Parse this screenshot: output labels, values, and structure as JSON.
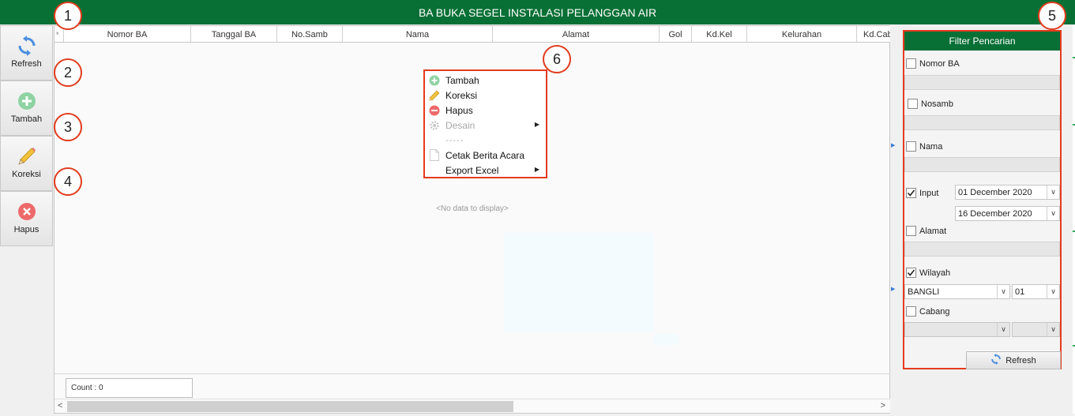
{
  "app": {
    "title": "BA BUKA SEGEL INSTALASI PELANGGAN AIR"
  },
  "toolbar": {
    "refresh_label": "Refresh",
    "tambah_label": "Tambah",
    "koreksi_label": "Koreksi",
    "hapus_label": "Hapus"
  },
  "grid": {
    "row_indicator": "*",
    "columns": [
      "Nomor BA",
      "Tanggal BA",
      "No.Samb",
      "Nama",
      "Alamat",
      "Gol",
      "Kd.Kel",
      "Kelurahan",
      "Kd.Cab"
    ],
    "empty_text": "<No data to display>",
    "count_text": "Count : 0"
  },
  "context_menu": {
    "items": [
      {
        "label": "Tambah",
        "icon": "plus-circle-icon",
        "enabled": true,
        "submenu": false
      },
      {
        "label": "Koreksi",
        "icon": "pencil-icon",
        "enabled": true,
        "submenu": false
      },
      {
        "label": "Hapus",
        "icon": "minus-circle-icon",
        "enabled": true,
        "submenu": false
      },
      {
        "label": "Desain",
        "icon": "gear-icon",
        "enabled": false,
        "submenu": true
      },
      {
        "label": "-----",
        "separator": true
      },
      {
        "label": "Cetak Berita Acara",
        "icon": "document-icon",
        "enabled": true,
        "submenu": false
      },
      {
        "label": "Export Excel",
        "icon": "",
        "enabled": true,
        "submenu": true
      }
    ]
  },
  "filter": {
    "title": "Filter Pencarian",
    "nomor_ba": {
      "label": "Nomor BA",
      "checked": false,
      "value": ""
    },
    "nosamb": {
      "label": "Nosamb",
      "checked": false,
      "value": ""
    },
    "nama": {
      "label": "Nama",
      "checked": false,
      "value": ""
    },
    "input": {
      "label": "Input",
      "checked": true,
      "date_from": "01 December 2020",
      "date_to": "16 December 2020"
    },
    "alamat": {
      "label": "Alamat",
      "checked": false,
      "value": ""
    },
    "wilayah": {
      "label": "Wilayah",
      "checked": true,
      "name": "BANGLI",
      "code": "01"
    },
    "cabang": {
      "label": "Cabang",
      "checked": false,
      "name": "",
      "code": ""
    },
    "refresh_label": "Refresh"
  },
  "annotations": [
    "1",
    "2",
    "3",
    "4",
    "5",
    "6"
  ],
  "colors": {
    "title_bar": "#087035",
    "highlight": "#e53b1f",
    "refresh_icon": "#4a8fe0",
    "add_icon": "#8fd3a3",
    "delete_icon": "#ee6a6a"
  }
}
